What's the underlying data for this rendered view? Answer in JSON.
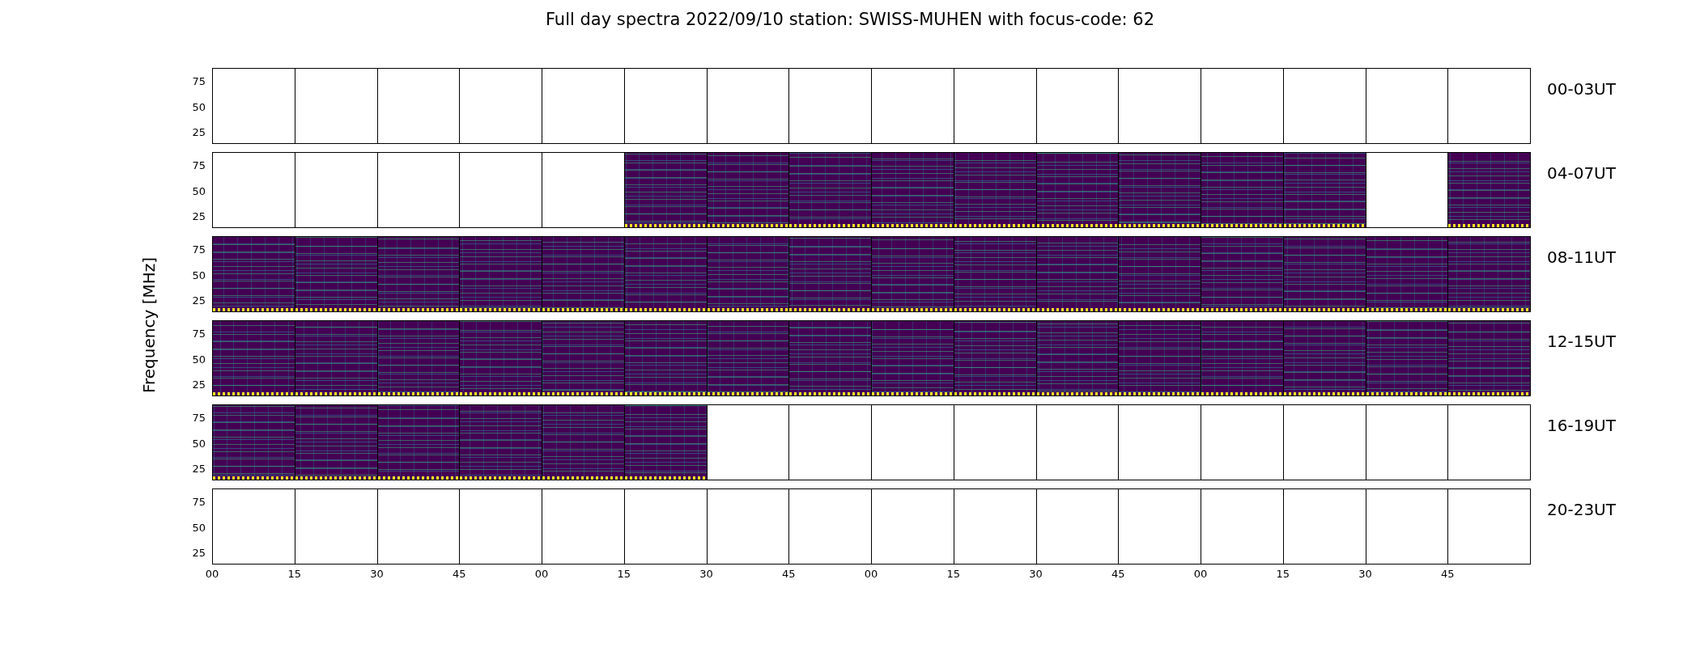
{
  "title": "Full day spectra 2022/09/10 station: SWISS-MUHEN with focus-code: 62",
  "ylabel": "Frequency [MHz]",
  "rows": [
    {
      "label": "00-03UT",
      "yticks": [
        "75",
        "50",
        "25"
      ],
      "panels": [
        {
          "has_data": false
        },
        {
          "has_data": false
        },
        {
          "has_data": false
        },
        {
          "has_data": false
        },
        {
          "has_data": false
        },
        {
          "has_data": false
        },
        {
          "has_data": false
        },
        {
          "has_data": false
        },
        {
          "has_data": false
        },
        {
          "has_data": false
        },
        {
          "has_data": false
        },
        {
          "has_data": false
        },
        {
          "has_data": false
        },
        {
          "has_data": false
        },
        {
          "has_data": false
        },
        {
          "has_data": false
        }
      ]
    },
    {
      "label": "04-07UT",
      "yticks": [
        "75",
        "50",
        "25"
      ],
      "panels": [
        {
          "has_data": false
        },
        {
          "has_data": false
        },
        {
          "has_data": false
        },
        {
          "has_data": false
        },
        {
          "has_data": false
        },
        {
          "has_data": true
        },
        {
          "has_data": true
        },
        {
          "has_data": true
        },
        {
          "has_data": true
        },
        {
          "has_data": true
        },
        {
          "has_data": true
        },
        {
          "has_data": true
        },
        {
          "has_data": true
        },
        {
          "has_data": true
        },
        {
          "has_data": false
        },
        {
          "has_data": true
        }
      ]
    },
    {
      "label": "08-11UT",
      "yticks": [
        "75",
        "50",
        "25"
      ],
      "panels": [
        {
          "has_data": true
        },
        {
          "has_data": true
        },
        {
          "has_data": true
        },
        {
          "has_data": true
        },
        {
          "has_data": true
        },
        {
          "has_data": true
        },
        {
          "has_data": true
        },
        {
          "has_data": true
        },
        {
          "has_data": true
        },
        {
          "has_data": true
        },
        {
          "has_data": true
        },
        {
          "has_data": true
        },
        {
          "has_data": true
        },
        {
          "has_data": true
        },
        {
          "has_data": true
        },
        {
          "has_data": true
        }
      ]
    },
    {
      "label": "12-15UT",
      "yticks": [
        "75",
        "50",
        "25"
      ],
      "panels": [
        {
          "has_data": true
        },
        {
          "has_data": true
        },
        {
          "has_data": true
        },
        {
          "has_data": true
        },
        {
          "has_data": true
        },
        {
          "has_data": true
        },
        {
          "has_data": true
        },
        {
          "has_data": true
        },
        {
          "has_data": true
        },
        {
          "has_data": true
        },
        {
          "has_data": true
        },
        {
          "has_data": true
        },
        {
          "has_data": true
        },
        {
          "has_data": true
        },
        {
          "has_data": true
        },
        {
          "has_data": true
        }
      ]
    },
    {
      "label": "16-19UT",
      "yticks": [
        "75",
        "50",
        "25"
      ],
      "panels": [
        {
          "has_data": true
        },
        {
          "has_data": true
        },
        {
          "has_data": true
        },
        {
          "has_data": true
        },
        {
          "has_data": true
        },
        {
          "has_data": true
        },
        {
          "has_data": false
        },
        {
          "has_data": false
        },
        {
          "has_data": false
        },
        {
          "has_data": false
        },
        {
          "has_data": false
        },
        {
          "has_data": false
        },
        {
          "has_data": false
        },
        {
          "has_data": false
        },
        {
          "has_data": false
        },
        {
          "has_data": false
        }
      ]
    },
    {
      "label": "20-23UT",
      "yticks": [
        "75",
        "50",
        "25"
      ],
      "panels": [
        {
          "has_data": false
        },
        {
          "has_data": false
        },
        {
          "has_data": false
        },
        {
          "has_data": false
        },
        {
          "has_data": false
        },
        {
          "has_data": false
        },
        {
          "has_data": false
        },
        {
          "has_data": false
        },
        {
          "has_data": false
        },
        {
          "has_data": false
        },
        {
          "has_data": false
        },
        {
          "has_data": false
        },
        {
          "has_data": false
        },
        {
          "has_data": false
        },
        {
          "has_data": false
        },
        {
          "has_data": false
        }
      ]
    }
  ],
  "xticks": [
    "00",
    "15",
    "30",
    "45",
    "00",
    "15",
    "30",
    "45",
    "00",
    "15",
    "30",
    "45",
    "00",
    "15",
    "30",
    "45"
  ]
}
